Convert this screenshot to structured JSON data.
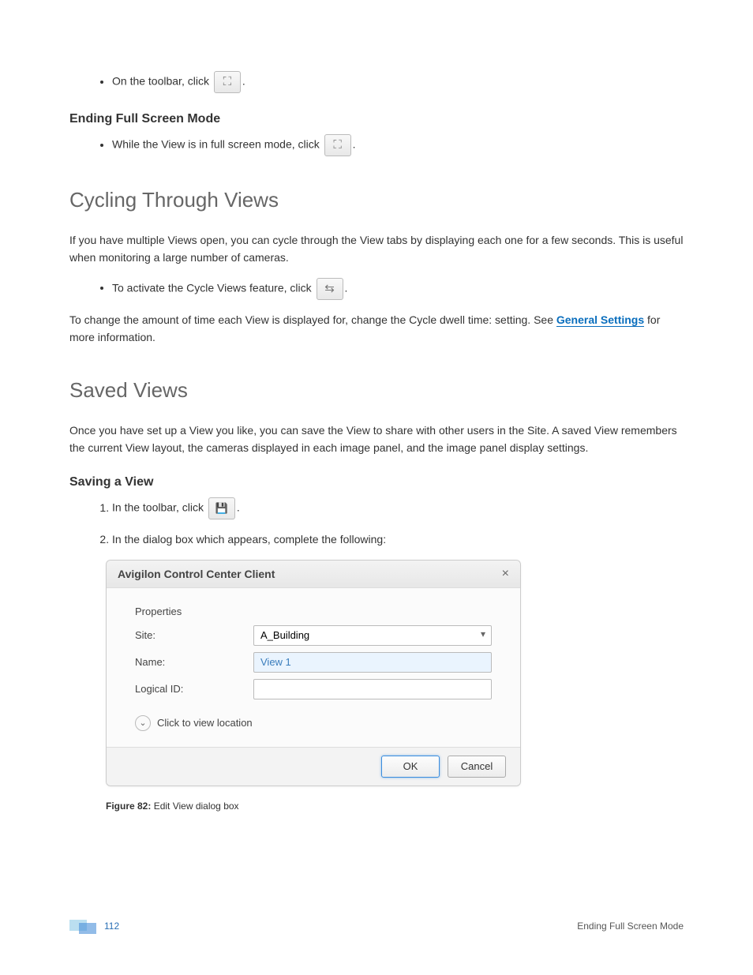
{
  "bullet1_pre": "On the toolbar, click ",
  "bullet1_post": ".",
  "ending_heading": "Ending Full Screen Mode",
  "bullet2_pre": "While the View is in full screen mode, click ",
  "bullet2_post": ".",
  "cycling_heading": "Cycling Through Views",
  "cycling_p1": "If you have multiple Views open, you can cycle through the View tabs by displaying each one for a few seconds. This is useful when monitoring a large number of cameras.",
  "bullet3_pre": "To activate the Cycle Views feature, click ",
  "bullet3_post": ".",
  "cycling_p2_pre": "To change the amount of time each View is displayed for, change the Cycle dwell time: setting. See ",
  "cycling_link": "General Settings",
  "cycling_p2_post": " for more information.",
  "saved_heading": "Saved Views",
  "saved_p1": "Once you have set up a View you like, you can save the View to share with other users in the Site. A saved View remembers the current View layout, the cameras displayed in each image panel, and the image panel display settings.",
  "saving_heading": "Saving a View",
  "step1_pre": "In the toolbar, click ",
  "step1_post": ".",
  "step2": "In the dialog box which appears, complete the following:",
  "dialog": {
    "title": "Avigilon Control Center Client",
    "properties": "Properties",
    "site_label": "Site:",
    "site_value": "A_Building",
    "name_label": "Name:",
    "name_value": "View 1",
    "logical_label": "Logical ID:",
    "logical_value": "",
    "expand": "Click to view location",
    "ok": "OK",
    "cancel": "Cancel"
  },
  "caption_b": "Figure 82: ",
  "caption_t": "Edit View dialog box",
  "page_number": "112",
  "footer_chapter": "Ending Full Screen Mode",
  "icons": {
    "fullscreen": "⛶",
    "cycle": "⇆",
    "save": "💾"
  }
}
